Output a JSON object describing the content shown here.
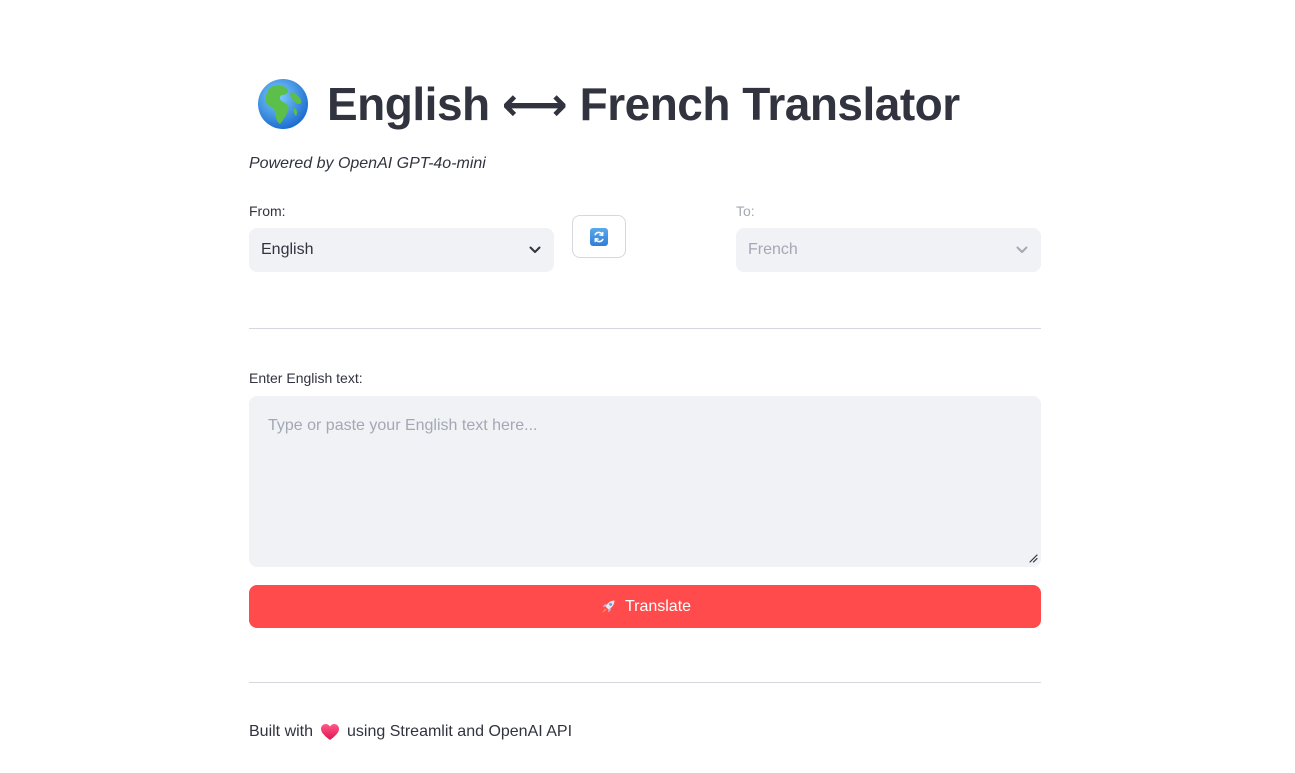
{
  "header": {
    "globe_icon": "globe-europe-africa-icon",
    "title": "English ⟷ French Translator",
    "subtitle": "Powered by OpenAI GPT-4o-mini"
  },
  "languages": {
    "from_label": "From:",
    "from_value": "English",
    "to_label": "To:",
    "to_value": "French",
    "swap_icon": "swap-arrows-icon"
  },
  "input": {
    "label": "Enter English text:",
    "placeholder": "Type or paste your English text here..."
  },
  "actions": {
    "translate_label": "Translate",
    "translate_icon": "rocket-icon",
    "accent_color": "#ff4b4b"
  },
  "footer": {
    "prefix": "Built with",
    "heart_icon": "heart-icon",
    "suffix": "using Streamlit and OpenAI API"
  }
}
